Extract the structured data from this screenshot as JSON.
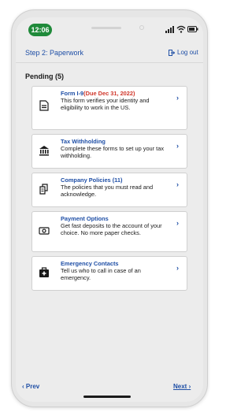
{
  "status_bar": {
    "time": "12:06"
  },
  "header": {
    "step_title": "Step 2: Paperwork",
    "logout_label": "Log out"
  },
  "section": {
    "title": "Pending (5)"
  },
  "tasks": [
    {
      "title": "Form I-9",
      "due": "(Due Dec 31, 2022)",
      "desc": "This form verifies your identity and eligibility to work in the US.",
      "icon": "document-icon"
    },
    {
      "title": "Tax Withholding",
      "due": "",
      "desc": "Complete these forms to set up your tax withholding.",
      "icon": "bank-icon"
    },
    {
      "title": "Company Policies (11)",
      "due": "",
      "desc": "The policies that you must read and acknowledge.",
      "icon": "documents-icon"
    },
    {
      "title": "Payment Options",
      "due": "",
      "desc": "Get fast deposits to the account of your choice. No more paper checks.",
      "icon": "money-icon"
    },
    {
      "title": "Emergency Contacts",
      "due": "",
      "desc": "Tell us who to call in case of an emergency.",
      "icon": "first-aid-icon"
    }
  ],
  "footer": {
    "prev_label": "Prev",
    "next_label": "Next"
  },
  "colors": {
    "link": "#1f4fa6",
    "due": "#d0372b",
    "time_pill": "#1f8a3a"
  }
}
